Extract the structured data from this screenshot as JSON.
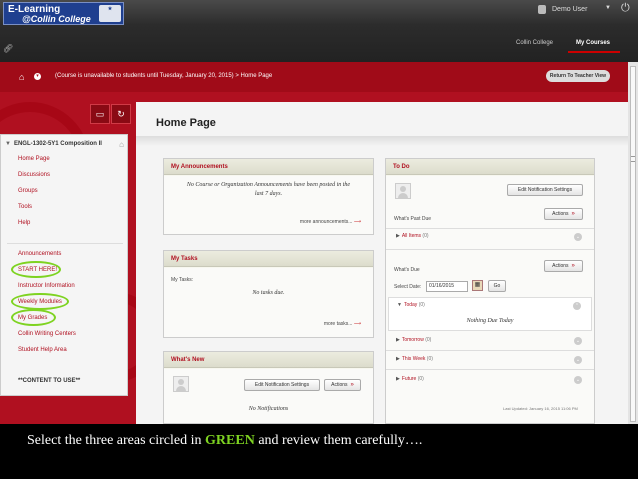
{
  "header": {
    "logo_line1": "E-Learning",
    "logo_line2": "@Collin College",
    "logo_seal": "COLLIN COLLEGE",
    "user_name": "Demo User",
    "nav": [
      "Collin College",
      "My Courses"
    ],
    "icons": [
      "link-icon",
      "power-icon",
      "user-avatar-icon"
    ]
  },
  "course_bar": {
    "breadcrumb": "(Course is unavailable to students until Tuesday, January 20, 2015)",
    "separator": ">",
    "current": "Home Page",
    "return_button": "Return To Teacher View"
  },
  "sidebar": {
    "course_title": "ENGL-1302-5Y1 Composition II",
    "items": [
      "Home Page",
      "Discussions",
      "Groups",
      "Tools",
      "Help"
    ],
    "items2": [
      "Announcements",
      "START HERE!",
      "Instructor Information",
      "Weekly Modules",
      "My Grades",
      "Collin Writing Centers",
      "Student Help Area"
    ],
    "content_label": "**CONTENT TO USE**",
    "circled": [
      "START HERE!",
      "Weekly Modules",
      "My Grades"
    ],
    "highlight_color": "#7ed321"
  },
  "main": {
    "title": "Home Page",
    "announcements": {
      "title": "My Announcements",
      "message": "No Course or Organization Announcements have been posted in the last 7 days.",
      "more": "more announcements..."
    },
    "tasks": {
      "title": "My Tasks",
      "label": "My Tasks:",
      "message": "No tasks due.",
      "more": "more tasks..."
    },
    "whats_new": {
      "title": "What's New",
      "notif_button": "Edit Notification Settings",
      "actions": "Actions",
      "message": "No Notifications"
    },
    "todo": {
      "title": "To Do",
      "notif_button": "Edit Notification Settings",
      "past_due_label": "What's Past Due",
      "actions": "Actions",
      "all_items": "All Items",
      "all_items_count": "(0)",
      "due_label": "What's Due",
      "select_date_label": "Select Date:",
      "date_value": "01/16/2015",
      "go": "Go",
      "today": "Today",
      "today_count": "(0)",
      "nothing_due": "Nothing Due Today",
      "tomorrow": "Tomorrow",
      "tomorrow_count": "(0)",
      "this_week": "This Week",
      "this_week_count": "(0)",
      "future": "Future",
      "future_count": "(0)",
      "last_updated": "Last Updated: January 16, 2015 11:06 PM"
    }
  },
  "caption": {
    "before": "Select the three areas circled in ",
    "green": "GREEN",
    "after": " and review them carefully….",
    "green_color": "#7ed321"
  }
}
